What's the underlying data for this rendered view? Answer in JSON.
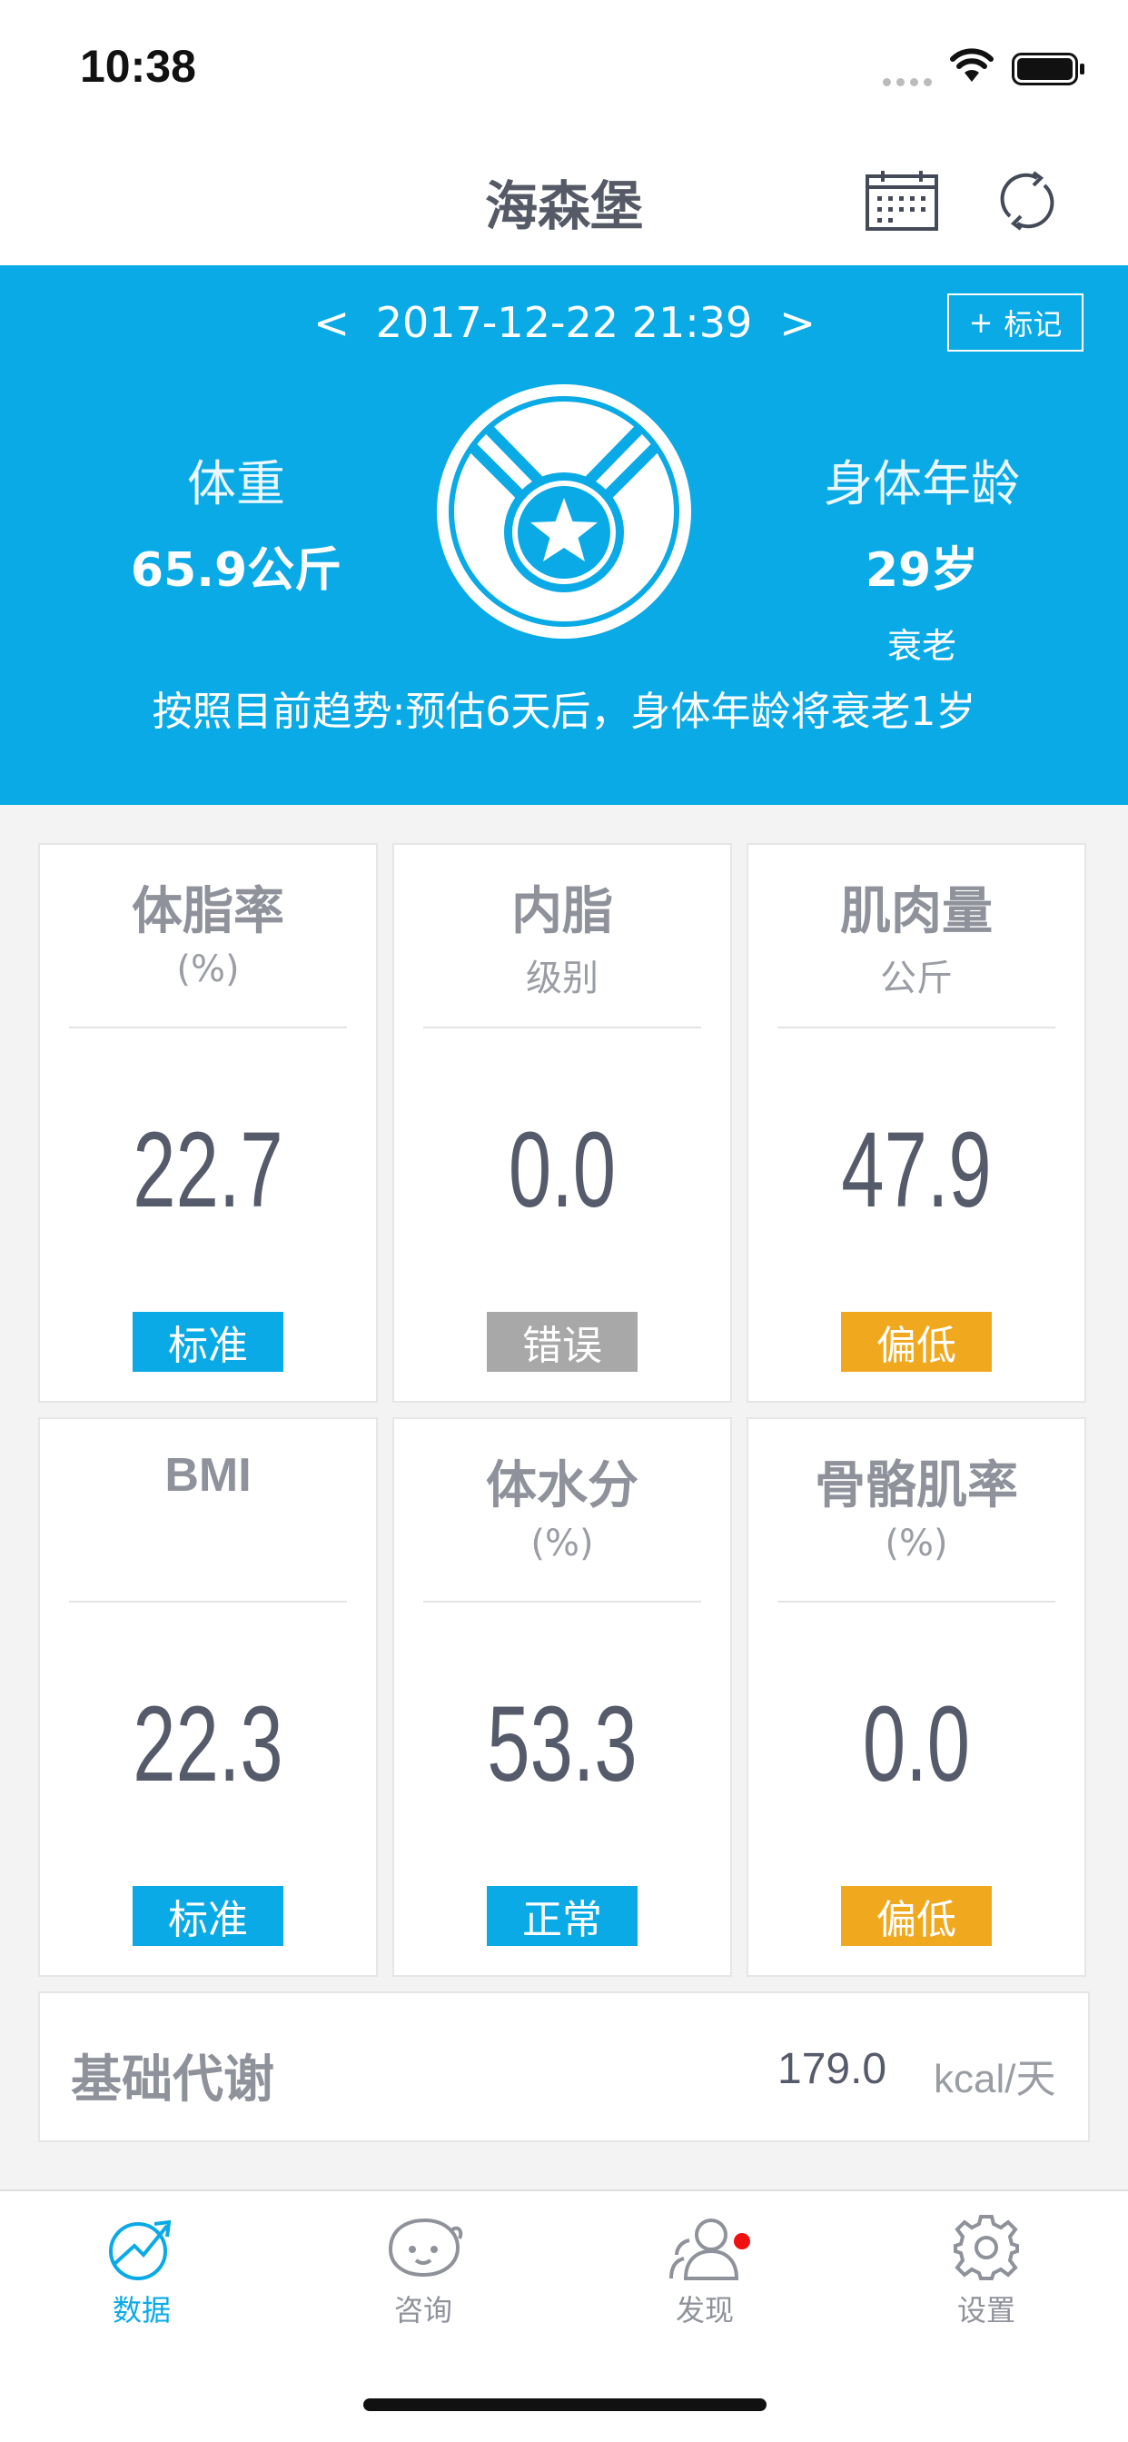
{
  "status_bar": {
    "time": "10:38"
  },
  "nav": {
    "title": "海森堡"
  },
  "hero": {
    "prev": "<",
    "next": ">",
    "date": "2017-12-22 21:39",
    "mark_plus": "+",
    "mark_label": "标记",
    "weight_label": "体重",
    "weight_value": "65.9公斤",
    "age_label": "身体年龄",
    "age_value": "29岁",
    "age_status": "衰老",
    "trend": "按照目前趋势:预估6天后，身体年龄将衰老1岁"
  },
  "metrics": [
    {
      "title": "体脂率",
      "unit": "(%)",
      "value": "22.7",
      "status": "标准",
      "status_color": "#0aaae6"
    },
    {
      "title": "内脂",
      "unit": "级别",
      "value": "0.0",
      "status": "错误",
      "status_color": "#a8a8a8"
    },
    {
      "title": "肌肉量",
      "unit": "公斤",
      "value": "47.9",
      "status": "偏低",
      "status_color": "#f0a81e"
    },
    {
      "title": "BMI",
      "unit": "",
      "value": "22.3",
      "status": "标准",
      "status_color": "#0aaae6"
    },
    {
      "title": "体水分",
      "unit": "(%)",
      "value": "53.3",
      "status": "正常",
      "status_color": "#0aaae6"
    },
    {
      "title": "骨骼肌率",
      "unit": "(%)",
      "value": "0.0",
      "status": "偏低",
      "status_color": "#f0a81e"
    }
  ],
  "bmr": {
    "label": "基础代谢",
    "value": "179.0",
    "unit": "kcal/天"
  },
  "tabs": [
    {
      "label": "数据",
      "icon": "chart-arrow-icon",
      "active": true
    },
    {
      "label": "咨询",
      "icon": "chat-face-icon",
      "active": false
    },
    {
      "label": "发现",
      "icon": "people-icon",
      "active": false,
      "badge": true
    },
    {
      "label": "设置",
      "icon": "gear-icon",
      "active": false
    }
  ],
  "colors": {
    "accent": "#0aaae6",
    "warning": "#f0a81e",
    "error": "#a8a8a8"
  }
}
